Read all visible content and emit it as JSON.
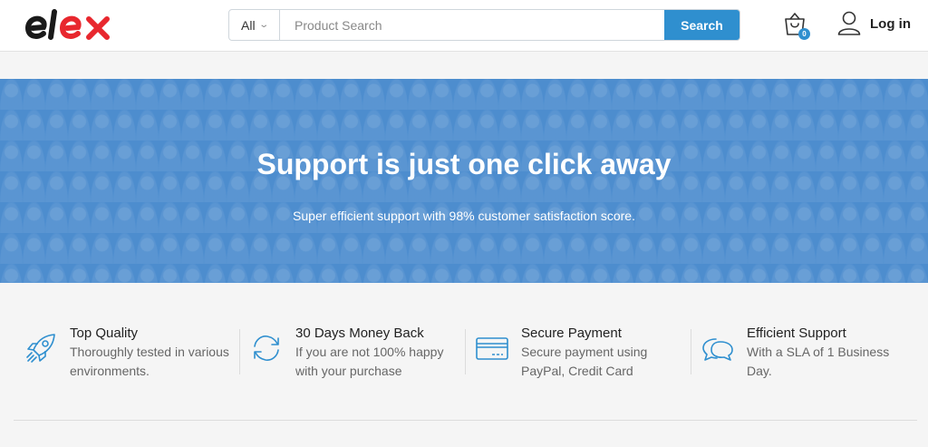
{
  "header": {
    "logo_text": "elex",
    "search": {
      "category": "All",
      "placeholder": "Product Search",
      "button_label": "Search"
    },
    "cart_count": "0",
    "login_label": "Log in"
  },
  "banner": {
    "title": "Support is just one click away",
    "subtitle": "Super efficient support with 98% customer satisfaction score."
  },
  "features": [
    {
      "title": "Top Quality",
      "desc": "Thoroughly tested in various environments.",
      "icon": "rocket-icon"
    },
    {
      "title": "30 Days Money Back",
      "desc": "If you are not 100% happy with your purchase",
      "icon": "refresh-icon"
    },
    {
      "title": "Secure Payment",
      "desc": "Secure payment using PayPal, Credit Card",
      "icon": "credit-card-icon"
    },
    {
      "title": "Efficient Support",
      "desc": "With a SLA of 1 Business Day.",
      "icon": "chat-icon"
    }
  ],
  "colors": {
    "accent": "#2f8fcf",
    "banner": "#5193d5",
    "logo_dark": "#1a1a1a",
    "logo_red": "#e8272e"
  }
}
